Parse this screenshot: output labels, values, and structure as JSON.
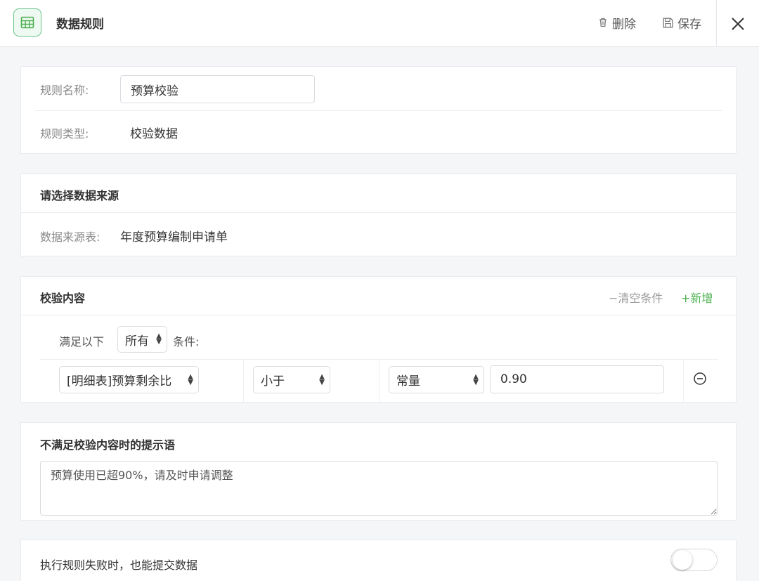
{
  "header": {
    "title": "数据规则",
    "delete_label": "删除",
    "save_label": "保存"
  },
  "rule": {
    "name_label": "规则名称:",
    "name_value": "预算校验",
    "type_label": "规则类型:",
    "type_value": "校验数据"
  },
  "source": {
    "title": "请选择数据来源",
    "table_label": "数据来源表:",
    "table_value": "年度预算编制申请单"
  },
  "validation": {
    "title": "校验内容",
    "clear_label": "清空条件",
    "add_label": "新增",
    "prefix": "满足以下",
    "match_select": "所有",
    "suffix": "条件:",
    "condition": {
      "field": "[明细表]预算剩余比",
      "operator": "小于",
      "value_type": "常量",
      "value": "0.90"
    }
  },
  "tip": {
    "title": "不满足校验内容时的提示语",
    "text": "预算使用已超90%，请及时申请调整"
  },
  "fail_submit": {
    "label": "执行规则失败时，也能提交数据",
    "enabled": false
  },
  "colors": {
    "accent_green": "#4cb050",
    "icon_green": "#69c389"
  }
}
